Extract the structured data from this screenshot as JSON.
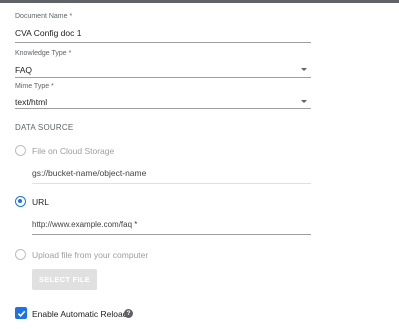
{
  "form": {
    "document_name": {
      "label": "Document Name *",
      "value": "CVA Config doc 1"
    },
    "knowledge_type": {
      "label": "Knowledge Type *",
      "value": "FAQ"
    },
    "mime_type": {
      "label": "Mime Type *",
      "value": "text/html"
    }
  },
  "data_source": {
    "heading": "DATA SOURCE",
    "options": [
      {
        "label": "File on Cloud Storage",
        "selected": false,
        "input_value": "gs://bucket-name/object-name"
      },
      {
        "label": "URL",
        "selected": true,
        "input_value": "http://www.example.com/faq *"
      },
      {
        "label": "Upload file from your computer",
        "selected": false,
        "button_label": "SELECT FILE"
      }
    ]
  },
  "auto_reload": {
    "label": "Enable Automatic Reload",
    "checked": true,
    "help_icon": "?"
  },
  "colors": {
    "accent": "#1a73e8",
    "disabled": "#9e9e9e"
  }
}
